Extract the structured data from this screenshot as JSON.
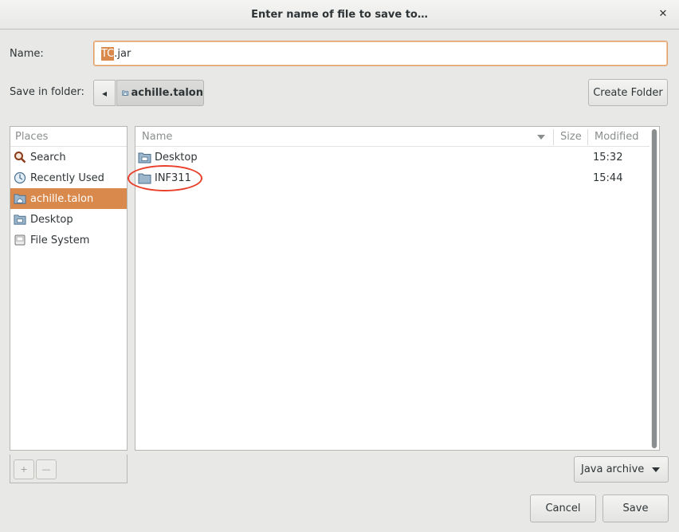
{
  "window": {
    "title": "Enter name of file to save to…",
    "close_glyph": "✕"
  },
  "name_row": {
    "label": "Name:",
    "value_selected": "TC",
    "value_rest": ".jar"
  },
  "folder_row": {
    "label": "Save in folder:",
    "back_glyph": "◂",
    "current_folder": "achille.talon",
    "create_folder_label": "Create Folder"
  },
  "places": {
    "header": "Places",
    "items": [
      {
        "label": "Search",
        "icon": "search-icon",
        "selected": false
      },
      {
        "label": "Recently Used",
        "icon": "recent-icon",
        "selected": false
      },
      {
        "label": "achille.talon",
        "icon": "home-folder-icon",
        "selected": true
      },
      {
        "label": "Desktop",
        "icon": "desktop-folder-icon",
        "selected": false
      },
      {
        "label": "File System",
        "icon": "drive-icon",
        "selected": false
      }
    ],
    "add_glyph": "+",
    "remove_glyph": "—"
  },
  "files": {
    "columns": {
      "name": "Name",
      "size": "Size",
      "modified": "Modified"
    },
    "rows": [
      {
        "name": "Desktop",
        "size": "",
        "modified": "15:32",
        "icon": "desktop-folder-icon"
      },
      {
        "name": "INF311",
        "size": "",
        "modified": "15:44",
        "icon": "folder-icon"
      }
    ]
  },
  "filter": {
    "selected": "Java archive"
  },
  "actions": {
    "cancel_label": "Cancel",
    "save_label": "Save"
  },
  "colors": {
    "accent": "#d8894b",
    "annotation": "#e8402a",
    "background": "#e8e8e7"
  }
}
